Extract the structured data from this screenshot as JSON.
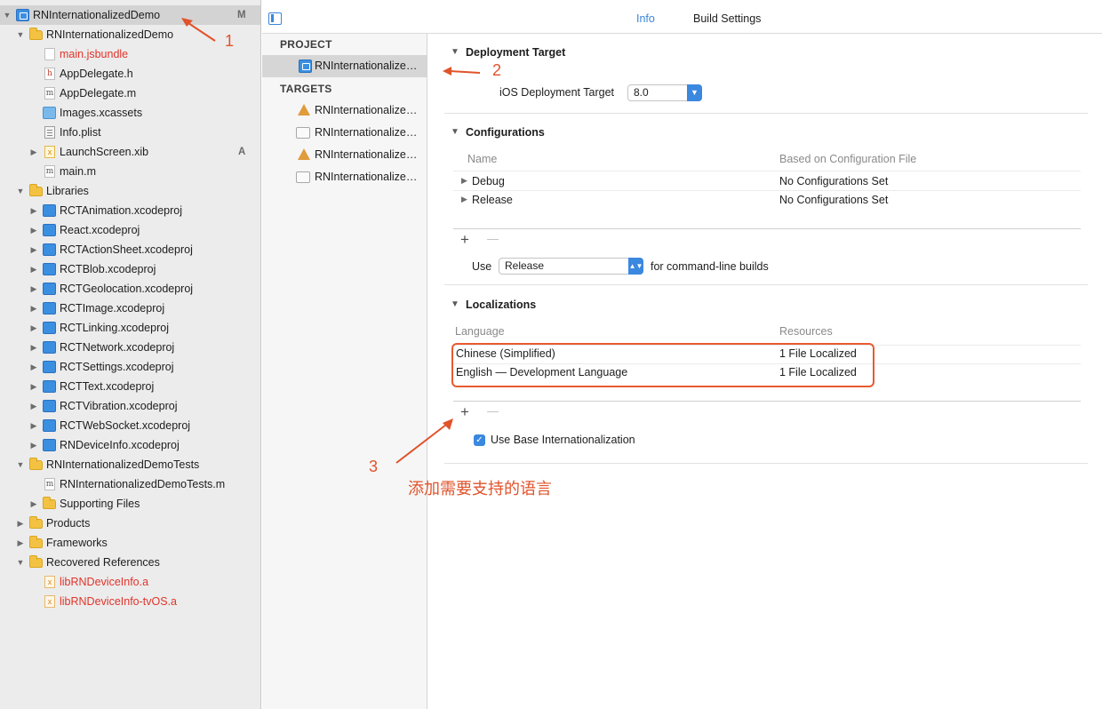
{
  "navigator": {
    "items": [
      {
        "label": "RNInternationalizedDemo",
        "badge": "M",
        "icon": "project-icon",
        "red": false
      },
      {
        "label": "RNInternationalizedDemo",
        "badge": "",
        "icon": "folder-icon",
        "red": false
      },
      {
        "label": "main.jsbundle",
        "badge": "",
        "icon": "file-icon",
        "red": true
      },
      {
        "label": "AppDelegate.h",
        "badge": "",
        "icon": "header-file-icon",
        "icon_glyph": "h",
        "red": false
      },
      {
        "label": "AppDelegate.m",
        "badge": "",
        "icon": "objc-file-icon",
        "icon_glyph": "m",
        "red": false
      },
      {
        "label": "Images.xcassets",
        "badge": "",
        "icon": "asset-catalog-icon",
        "red": false
      },
      {
        "label": "Info.plist",
        "badge": "",
        "icon": "plist-icon",
        "red": false
      },
      {
        "label": "LaunchScreen.xib",
        "badge": "A",
        "icon": "xib-icon",
        "icon_glyph": "x",
        "red": false
      },
      {
        "label": "main.m",
        "badge": "",
        "icon": "objc-file-icon",
        "icon_glyph": "m",
        "red": false
      },
      {
        "label": "Libraries",
        "badge": "",
        "icon": "folder-icon",
        "red": false
      },
      {
        "label": "RCTAnimation.xcodeproj",
        "badge": "",
        "icon": "xcodeproj-icon",
        "red": false
      },
      {
        "label": "React.xcodeproj",
        "badge": "",
        "icon": "xcodeproj-icon",
        "red": false
      },
      {
        "label": "RCTActionSheet.xcodeproj",
        "badge": "",
        "icon": "xcodeproj-icon",
        "red": false
      },
      {
        "label": "RCTBlob.xcodeproj",
        "badge": "",
        "icon": "xcodeproj-icon",
        "red": false
      },
      {
        "label": "RCTGeolocation.xcodeproj",
        "badge": "",
        "icon": "xcodeproj-icon",
        "red": false
      },
      {
        "label": "RCTImage.xcodeproj",
        "badge": "",
        "icon": "xcodeproj-icon",
        "red": false
      },
      {
        "label": "RCTLinking.xcodeproj",
        "badge": "",
        "icon": "xcodeproj-icon",
        "red": false
      },
      {
        "label": "RCTNetwork.xcodeproj",
        "badge": "",
        "icon": "xcodeproj-icon",
        "red": false
      },
      {
        "label": "RCTSettings.xcodeproj",
        "badge": "",
        "icon": "xcodeproj-icon",
        "red": false
      },
      {
        "label": "RCTText.xcodeproj",
        "badge": "",
        "icon": "xcodeproj-icon",
        "red": false
      },
      {
        "label": "RCTVibration.xcodeproj",
        "badge": "",
        "icon": "xcodeproj-icon",
        "red": false
      },
      {
        "label": "RCTWebSocket.xcodeproj",
        "badge": "",
        "icon": "xcodeproj-icon",
        "red": false
      },
      {
        "label": "RNDeviceInfo.xcodeproj",
        "badge": "",
        "icon": "xcodeproj-icon",
        "red": false
      },
      {
        "label": "RNInternationalizedDemoTests",
        "badge": "",
        "icon": "folder-icon",
        "red": false
      },
      {
        "label": "RNInternationalizedDemoTests.m",
        "badge": "",
        "icon": "objc-file-icon",
        "icon_glyph": "m",
        "red": false
      },
      {
        "label": "Supporting Files",
        "badge": "",
        "icon": "folder-icon",
        "red": false
      },
      {
        "label": "Products",
        "badge": "",
        "icon": "folder-icon",
        "red": false
      },
      {
        "label": "Frameworks",
        "badge": "",
        "icon": "folder-icon",
        "red": false
      },
      {
        "label": "Recovered References",
        "badge": "",
        "icon": "folder-icon",
        "red": false
      },
      {
        "label": "libRNDeviceInfo.a",
        "badge": "",
        "icon": "library-icon",
        "icon_glyph": "x",
        "red": true
      },
      {
        "label": "libRNDeviceInfo-tvOS.a",
        "badge": "",
        "icon": "library-icon",
        "icon_glyph": "x",
        "red": true
      }
    ]
  },
  "tabs": {
    "info": "Info",
    "build_settings": "Build Settings"
  },
  "targetlist": {
    "project_header": "PROJECT",
    "project_item": "RNInternationalizedDemo",
    "targets_header": "TARGETS",
    "targets": [
      {
        "label": "RNInternationalizedDemo",
        "icon": "app-target-icon"
      },
      {
        "label": "RNInternationalizedDemoTests",
        "icon": "test-target-icon"
      },
      {
        "label": "RNInternationalizedDemo-tvOS",
        "icon": "app-target-icon"
      },
      {
        "label": "RNInternationalizedDemo-tvOSTests",
        "icon": "test-target-icon"
      }
    ]
  },
  "deployment": {
    "title": "Deployment Target",
    "ios_label": "iOS Deployment Target",
    "ios_value": "8.0"
  },
  "configurations": {
    "title": "Configurations",
    "col_name": "Name",
    "col_based": "Based on Configuration File",
    "rows": [
      {
        "name": "Debug",
        "based": "No Configurations Set"
      },
      {
        "name": "Release",
        "based": "No Configurations Set"
      }
    ],
    "use_label": "Use",
    "use_value": "Release",
    "use_suffix": "for command-line builds"
  },
  "localizations": {
    "title": "Localizations",
    "col_language": "Language",
    "col_resources": "Resources",
    "rows": [
      {
        "language": "Chinese (Simplified)",
        "resources": "1 File Localized"
      },
      {
        "language": "English — Development Language",
        "resources": "1 File Localized"
      }
    ],
    "use_base_label": "Use Base Internationalization",
    "use_base_checked": true
  },
  "controls": {
    "plus": "+",
    "minus": "—"
  },
  "annotations": {
    "n1": "1",
    "n2": "2",
    "n3": "3",
    "note": "添加需要支持的语言",
    "color": "#e0532b"
  },
  "colors": {
    "accent": "#3a86d8",
    "missing_file": "#e0342b"
  }
}
